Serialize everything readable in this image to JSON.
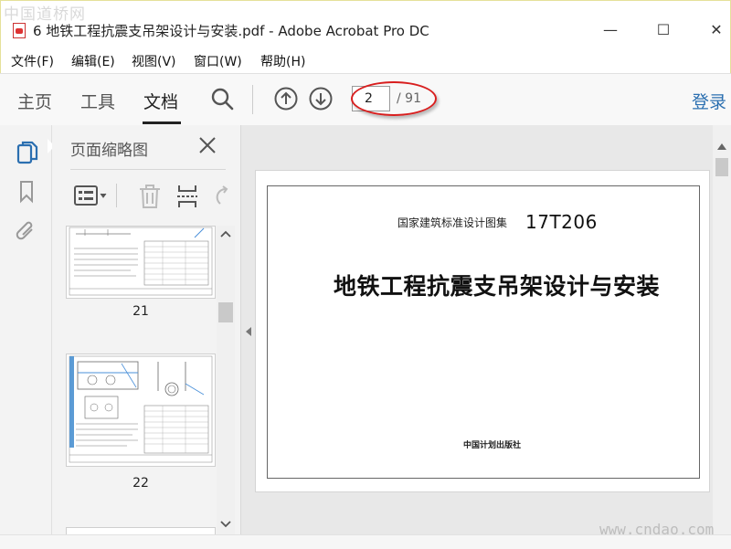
{
  "watermark_top": "中国道桥网",
  "window": {
    "title": "6 地铁工程抗震支吊架设计与安装.pdf - Adobe Acrobat Pro DC",
    "minimize": "—",
    "maximize": "☐",
    "close": "✕"
  },
  "menu": [
    {
      "label": "文件(F)"
    },
    {
      "label": "编辑(E)"
    },
    {
      "label": "视图(V)"
    },
    {
      "label": "窗口(W)"
    },
    {
      "label": "帮助(H)"
    }
  ],
  "toolbar": {
    "tabs": [
      {
        "label": "主页"
      },
      {
        "label": "工具"
      },
      {
        "label": "文档"
      }
    ],
    "active_tab": "文档",
    "page_current": "2",
    "page_total": "/ 91",
    "login_label": "登录"
  },
  "thumb_panel": {
    "title": "页面缩略图",
    "pages": [
      {
        "label": "21"
      },
      {
        "label": "22"
      }
    ]
  },
  "document": {
    "series": "国家建筑标准设计图集",
    "code": "17T206",
    "title": "地铁工程抗震支吊架设计与安装",
    "publisher": "中国计划出版社"
  },
  "watermark_bottom": "www.cndao.com",
  "colors": {
    "accent": "#2b6fb0",
    "annotation_red": "#d81e1e",
    "toolbar_bg": "#f8f8f8",
    "panel_bg": "#f3f3f3"
  },
  "icons": [
    "pdf-file-icon",
    "search-icon",
    "arrow-up-circle-icon",
    "arrow-down-circle-icon",
    "pages-icon",
    "bookmark-icon",
    "paperclip-icon",
    "close-icon",
    "options-icon",
    "trash-icon",
    "insert-page-icon",
    "rotate-icon",
    "chevron-up-icon",
    "chevron-down-icon",
    "chevron-left-icon"
  ]
}
